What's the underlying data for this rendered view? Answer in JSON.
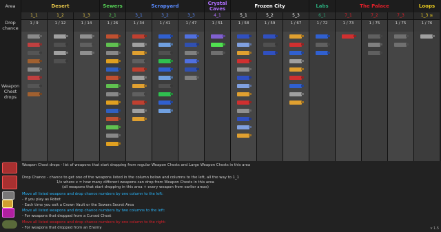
{
  "header": {
    "area_label": "Area",
    "drop_label": "Drop\nchance",
    "weapon_label": "Weapon\nChest\ndrops"
  },
  "areas": [
    {
      "name": "Desert",
      "color": "#e8c84a",
      "levels": [
        "1_1",
        "1_2",
        "1_3"
      ],
      "level_color": "#e8c84a"
    },
    {
      "name": "Sewers",
      "color": "#56d056",
      "levels": [
        "2_1"
      ],
      "level_color": "#56d056"
    },
    {
      "name": "Scrapyard",
      "color": "#5a8bff",
      "levels": [
        "3_1",
        "3_2",
        "3_3"
      ],
      "level_color": "#5a8bff"
    },
    {
      "name": "Crystal\nCaves",
      "color": "#b070ff",
      "levels": [
        "4_1"
      ],
      "level_color": "#b070ff"
    },
    {
      "name": "Frozen City",
      "color": "#ffffff",
      "levels": [
        "5_1",
        "5_2",
        "5_3"
      ],
      "level_color": "#ffffff"
    },
    {
      "name": "Labs",
      "color": "#2aa87a",
      "levels": [
        "6_1"
      ],
      "level_color": "#2aa87a"
    },
    {
      "name": "The Palace",
      "color": "#e0202a",
      "levels": [
        "7_1",
        "7_2",
        "7_3"
      ],
      "level_color": "#e0202a"
    },
    {
      "name": "Loops",
      "color": "#f0d020",
      "levels": [
        "1_3 ≤"
      ],
      "level_color": "#f0d020"
    }
  ],
  "chances": [
    "1 / 9",
    "1 / 12",
    "1 / 14",
    "1 / 26",
    "1 / 34",
    "1 / 41",
    "1 / 47",
    "1 / 51",
    "1 / 58",
    "1 / 59",
    "1 / 67",
    "1 / 72",
    "1 / 73",
    "1 / 75",
    "1 / 75",
    "1 / 76"
  ],
  "legend": {
    "weapon_chest": "Weapon Chest drops - list of weapons that start dropping from regular Weapon Chests and Large Weapon Chests in this area",
    "drop_chance_1": "Drop Chance - chance to get one of the weapons listed in the column below and columns to the left, all the way to 1_1",
    "drop_chance_2": "1/x where x = how many different weapons can drop from Weapon Chests in this area",
    "drop_chance_3": "(all weapons that start dropping in this area + every weapon from earlier areas)",
    "move_one": "Move all listed weapons and drop chance numbers by one column to the left:",
    "robot": "- If you play as Robot",
    "crown_vault": "- Each time you exit a Crown Vault or the Sewers Secret Area",
    "move_two": "Move all listed weapons and drop chance numbers by two columns to the left:",
    "cursed": "- For weapons that dropped from a Cursed Chest",
    "move_right": "Move all listed weapons and drop chance numbers by one column to the right:",
    "enemy": "- For weapons that dropped from an Enemy",
    "version": "v 1.5"
  },
  "colors": {
    "cyan": "#29b8ff",
    "red": "#e0202a",
    "desc": "#cfcfcf"
  }
}
